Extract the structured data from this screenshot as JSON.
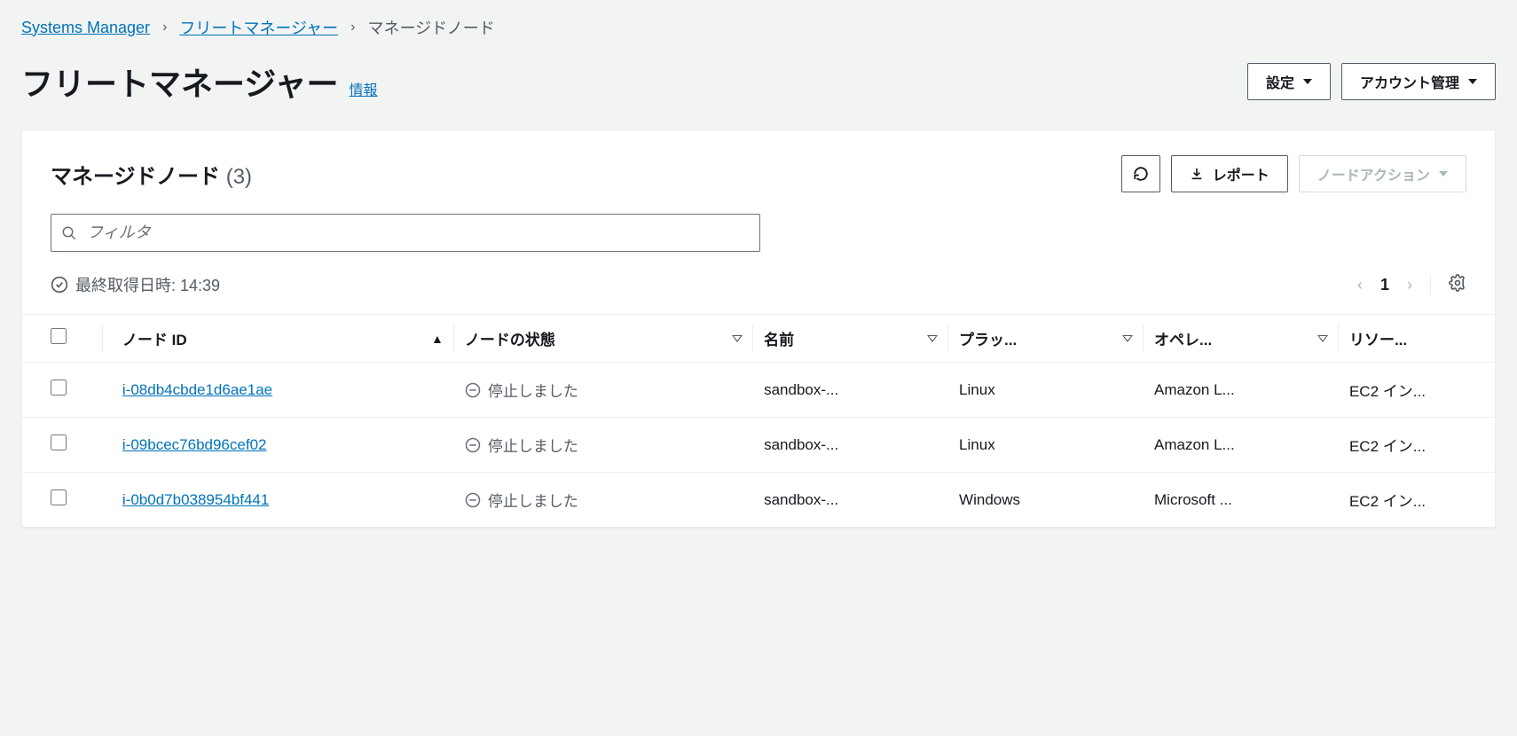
{
  "breadcrumbs": {
    "root": "Systems Manager",
    "fleet": "フリートマネージャー",
    "current": "マネージドノード"
  },
  "page": {
    "title": "フリートマネージャー",
    "info_link": "情報",
    "settings_btn": "設定",
    "account_btn": "アカウント管理"
  },
  "panel": {
    "title": "マネージドノード",
    "count": "(3)",
    "report_btn": "レポート",
    "node_action_btn": "ノードアクション",
    "filter_placeholder": "フィルタ",
    "last_fetched_label": "最終取得日時: 14:39",
    "page_number": "1"
  },
  "columns": {
    "node_id": "ノード ID",
    "state": "ノードの状態",
    "name": "名前",
    "platform": "プラッ...",
    "os": "オペレ...",
    "resource": "リソー..."
  },
  "rows": [
    {
      "id": "i-08db4cbde1d6ae1ae",
      "state": "停止しました",
      "name": "sandbox-...",
      "platform": "Linux",
      "os": "Amazon L...",
      "resource": "EC2 イン..."
    },
    {
      "id": "i-09bcec76bd96cef02",
      "state": "停止しました",
      "name": "sandbox-...",
      "platform": "Linux",
      "os": "Amazon L...",
      "resource": "EC2 イン..."
    },
    {
      "id": "i-0b0d7b038954bf441",
      "state": "停止しました",
      "name": "sandbox-...",
      "platform": "Windows",
      "os": "Microsoft ...",
      "resource": "EC2 イン..."
    }
  ]
}
